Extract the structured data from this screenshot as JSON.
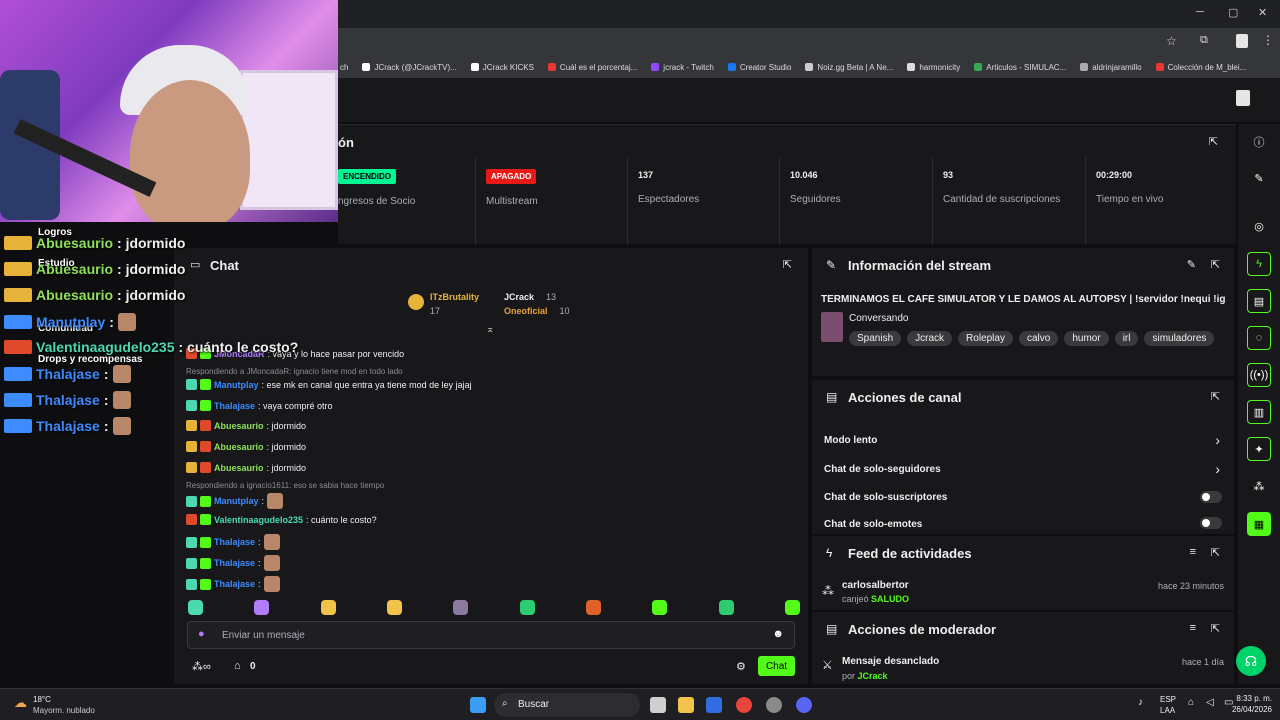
{
  "bookmarks": [
    "ch",
    "JCrack (@JCrackTV)...",
    "JCrack KICKS",
    "Cuál es el porcentaj...",
    "jcrack - Twitch",
    "Creator Studio",
    "Noiz.gg Beta | A Ne...",
    "harmonicity",
    "Articulos - SIMULAC...",
    "aldrinjaramillo",
    "Colección de M_blei..."
  ],
  "stats": {
    "title_fragment": "ón",
    "items": [
      {
        "value": "ENCENDIDO",
        "label": "ngresos de Socio",
        "badge_color": "#00f593",
        "badge_text_color": "#000"
      },
      {
        "value": "APAGADO",
        "label": "Multistream",
        "badge_color": "#e91916",
        "badge_text_color": "#fff"
      },
      {
        "value": "137",
        "label": "Espectadores"
      },
      {
        "value": "10.046",
        "label": "Seguidores"
      },
      {
        "value": "93",
        "label": "Cantidad de suscripciones"
      },
      {
        "value": "00:29:00",
        "label": "Tiempo en vivo"
      }
    ]
  },
  "overlay": {
    "menu": [
      "Logros",
      "Estudio",
      "Comunidad",
      "Drops y recompensas"
    ],
    "lines": [
      {
        "user": "Abuesaurio",
        "text": ": jdormido",
        "color": "#8ee05a"
      },
      {
        "user": "Abuesaurio",
        "text": ": jdormido",
        "color": "#8ee05a"
      },
      {
        "user": "Abuesaurio",
        "text": ": jdormido",
        "color": "#8ee05a"
      },
      {
        "user": "Manutplay",
        "text": ":",
        "color": "#3d8bff"
      },
      {
        "user": "Valentinaagudelo235",
        "text": ": cuánto le costo?",
        "color": "#4cd9b0"
      },
      {
        "user": "Thalajase",
        "text": ":",
        "color": "#3d8bff"
      },
      {
        "user": "Thalajase",
        "text": ":",
        "color": "#3d8bff"
      },
      {
        "user": "Thalajase",
        "text": ":",
        "color": "#3d8bff"
      }
    ]
  },
  "chat": {
    "title": "Chat",
    "leaders": [
      {
        "name": "ITzBrutality",
        "count": "17",
        "color": "#e7b23a"
      },
      {
        "name": "JCrack",
        "count": "13",
        "color": "#efeff1"
      },
      {
        "name": "Oneoficial",
        "count": "10",
        "color": "#e7a23a"
      }
    ],
    "messages": [
      {
        "kind": "msg",
        "user": "JMoncadaR",
        "text": ": vaya y lo hace pasar por vencido",
        "color": "#b27cff"
      },
      {
        "kind": "reply",
        "text": "Respondiendo a JMoncadaR: ignacio tiene mod en todo lado"
      },
      {
        "kind": "msg",
        "user": "Manutplay",
        "text": ": ese mk en canal que entra ya tiene mod de ley jajaj",
        "color": "#3d8bff"
      },
      {
        "kind": "msg",
        "user": "Thalajase",
        "text": ": vaya compré otro",
        "color": "#3d8bff"
      },
      {
        "kind": "msg",
        "user": "Abuesaurio",
        "text": ": jdormido",
        "color": "#8ee05a"
      },
      {
        "kind": "msg",
        "user": "Abuesaurio",
        "text": ": jdormido",
        "color": "#8ee05a"
      },
      {
        "kind": "msg",
        "user": "Abuesaurio",
        "text": ": jdormido",
        "color": "#8ee05a"
      },
      {
        "kind": "reply",
        "text": "Respondiendo a ignacio1611: eso se sabia hace tiempo"
      },
      {
        "kind": "msg",
        "user": "Manutplay",
        "text": ":",
        "color": "#3d8bff"
      },
      {
        "kind": "msg",
        "user": "Valentinaagudelo235",
        "text": ": cuánto le costo?",
        "color": "#4cd9b0"
      },
      {
        "kind": "msg",
        "user": "Thalajase",
        "text": ":",
        "color": "#3d8bff"
      },
      {
        "kind": "msg",
        "user": "Thalajase",
        "text": ":",
        "color": "#3d8bff"
      },
      {
        "kind": "msg",
        "user": "Thalajase",
        "text": ":",
        "color": "#3d8bff"
      }
    ],
    "input_placeholder": "Enviar un mensaje",
    "points": "0",
    "send_label": "Chat"
  },
  "stream_info": {
    "title": "Información del stream",
    "stream_title": "TERMINAMOS EL CAFE SIMULATOR Y LE DAMOS AL AUTOPSY | !servidor !nequi !ig",
    "category": "Conversando",
    "tags": [
      "Spanish",
      "Jcrack",
      "Roleplay",
      "calvo",
      "humor",
      "irl",
      "simuladores"
    ]
  },
  "channel_actions": {
    "title": "Acciones de canal",
    "rows": [
      "Modo lento",
      "Chat de solo-seguidores",
      "Chat de solo-suscriptores",
      "Chat de solo-emotes"
    ]
  },
  "activity": {
    "title": "Feed de actividades",
    "user": "carlosalbertor",
    "action": "canjeó",
    "reward": "SALUDO",
    "time": "hace 23 minutos"
  },
  "mod_actions": {
    "title": "Acciones de moderador",
    "action": "Mensaje desanclado",
    "by_label": "por",
    "by_user": "JCrack",
    "time": "hace 1 día"
  },
  "taskbar": {
    "weather_temp": "18°C",
    "weather_desc": "Mayorm. nublado",
    "search": "Buscar",
    "lang1": "ESP",
    "lang2": "LAA",
    "time": "8:33 p. m.",
    "date": "26/04/2026"
  },
  "colors": {
    "accent": "#53fc18",
    "panel": "#18181b",
    "bg": "#0e0e10"
  }
}
